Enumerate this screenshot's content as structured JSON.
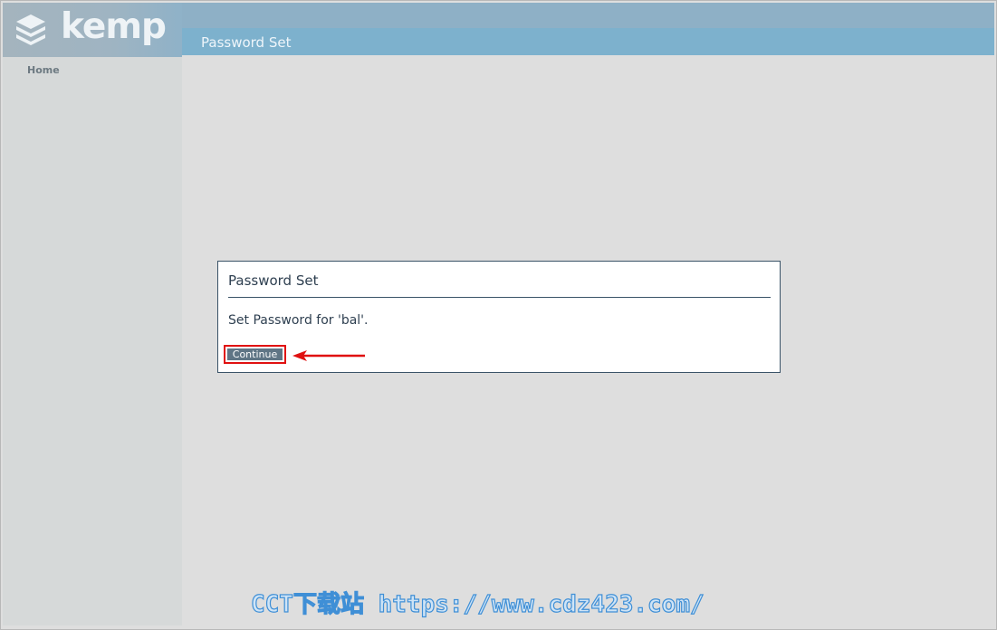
{
  "app": {
    "logo_text": "kemp"
  },
  "sidebar": {
    "items": [
      {
        "label": "Home"
      }
    ]
  },
  "header": {
    "title": "Password Set"
  },
  "dialog": {
    "title": "Password Set",
    "message": "Set Password for 'bal'.",
    "continue_label": "Continue"
  },
  "watermark": {
    "text": "CCT下载站 https://www.cdz423.com/"
  },
  "colors": {
    "header_bar": "#7db1cd",
    "button": "#5f7585",
    "highlight": "#e01010"
  }
}
